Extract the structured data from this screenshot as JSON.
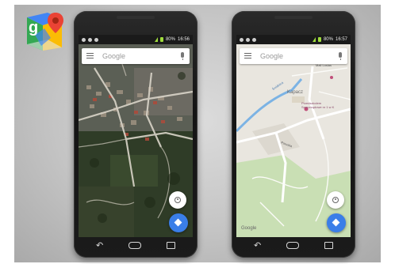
{
  "logo": {
    "icon": "google-maps-logo-icon",
    "letter": "g"
  },
  "phones": [
    {
      "map_type": "satellite",
      "status": {
        "battery": "80%",
        "time": "16:56"
      },
      "search": {
        "placeholder": "Google"
      },
      "nav": {
        "back": "back-icon",
        "home": "home-icon",
        "recent": "recent-apps-icon"
      }
    },
    {
      "map_type": "map",
      "status": {
        "battery": "80%",
        "time": "16:57"
      },
      "search": {
        "placeholder": "Google"
      },
      "map_labels": {
        "place": "Kapacz",
        "poi": "Przedszkolem Samorządowe nr 1 w K",
        "street_top": "Mali Losias",
        "street_left": "Świdnica",
        "street_mid": "Paruska"
      },
      "footer_mark": "Google",
      "nav": {
        "back": "back-icon",
        "home": "home-icon",
        "recent": "recent-apps-icon"
      }
    }
  ],
  "colors": {
    "accent_button": "#3a7ee8",
    "map_road": "#ffffff",
    "map_land": "#e9e6df",
    "map_park": "#c9dfb4",
    "map_water": "#7cb3e4"
  }
}
